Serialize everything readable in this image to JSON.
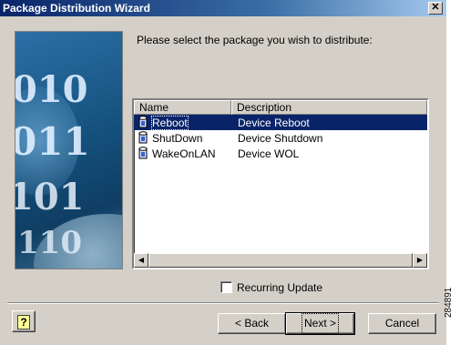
{
  "window": {
    "title": "Package Distribution Wizard",
    "close_label": "✕"
  },
  "banner": {
    "binary_rows": [
      "010",
      "011",
      "101",
      "110"
    ]
  },
  "prompt": "Please select the package you wish to distribute:",
  "list": {
    "columns": [
      "Name",
      "Description"
    ],
    "rows": [
      {
        "name": "Reboot",
        "description": "Device Reboot",
        "selected": true
      },
      {
        "name": "ShutDown",
        "description": "Device Shutdown",
        "selected": false
      },
      {
        "name": "WakeOnLAN",
        "description": "Device WOL",
        "selected": false
      }
    ],
    "scroll_left": "◀",
    "scroll_right": "▶"
  },
  "recurring_update": {
    "label": "Recurring Update",
    "checked": false
  },
  "buttons": {
    "help": "?",
    "back": "< Back",
    "next": "Next >",
    "cancel": "Cancel"
  },
  "figure_id": "284891",
  "colors": {
    "title_bar": "#0a246a",
    "dialog": "#d4d0c8",
    "selection": "#0a246a"
  }
}
